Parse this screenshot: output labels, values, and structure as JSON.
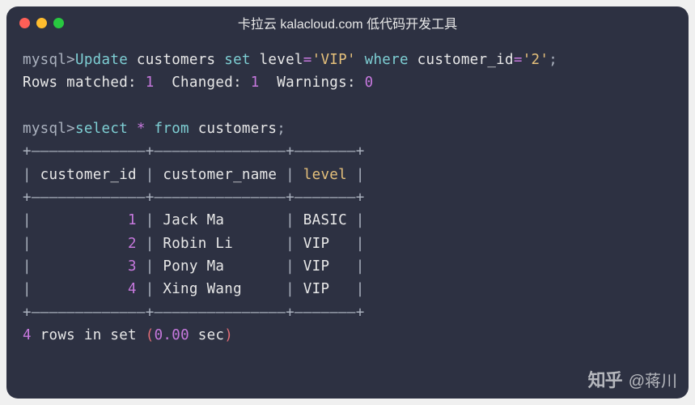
{
  "titlebar": {
    "title": "卡拉云 kalacloud.com 低代码开发工具"
  },
  "prompt": "mysql>",
  "query1": {
    "kw_update": "Update",
    "tbl": " customers ",
    "kw_set": "set",
    "col_level": " level",
    "eq1": "=",
    "val_vip": "'VIP'",
    "kw_where": " where",
    "col_cid": " customer_id",
    "eq2": "=",
    "val_2": "'2'",
    "semicolon": ";"
  },
  "result1": {
    "rows_matched_label": "Rows matched: ",
    "rows_matched": "1",
    "changed_label": "  Changed: ",
    "changed": "1",
    "warnings_label": "  Warnings: ",
    "warnings": "0"
  },
  "query2": {
    "kw_select": "select",
    "star": " * ",
    "kw_from": "from",
    "tbl": " customers",
    "semicolon": ";"
  },
  "table": {
    "border": "+—————————————+———————————————+———————+",
    "header": {
      "pipe": "|",
      "col1": " customer_id ",
      "col2": " customer_name ",
      "col3": " level ",
      "col3_hdr": "level"
    },
    "rows": [
      {
        "id": "1",
        "name": "Jack Ma",
        "level": "BASIC"
      },
      {
        "id": "2",
        "name": "Robin Li",
        "level": "VIP"
      },
      {
        "id": "3",
        "name": "Pony Ma",
        "level": "VIP"
      },
      {
        "id": "4",
        "name": "Xing Wang",
        "level": "VIP"
      }
    ]
  },
  "footer": {
    "count": "4",
    "rows_in_set": " rows in set ",
    "paren_open": "(",
    "time": "0.00",
    "sec": " sec",
    "paren_close": ")"
  },
  "watermark": {
    "logo": "知乎",
    "author": "@蒋川"
  }
}
